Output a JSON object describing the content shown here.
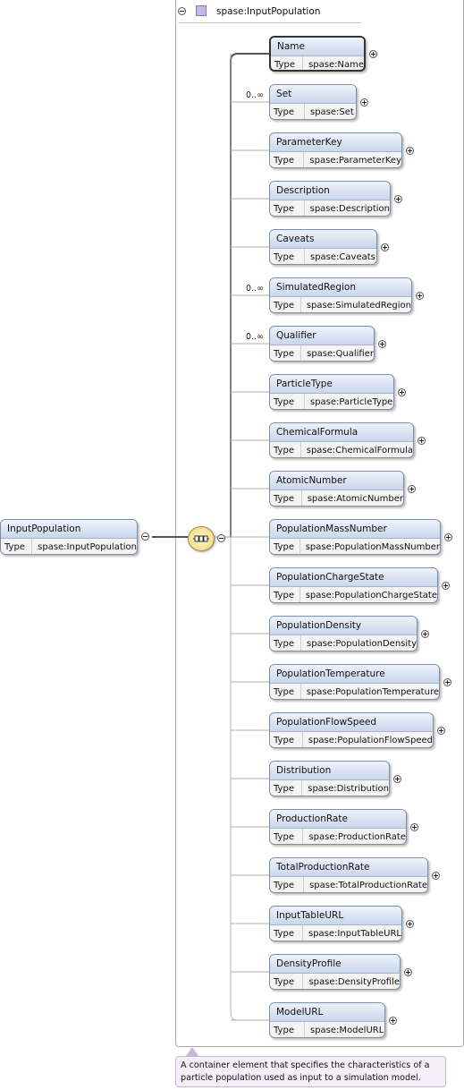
{
  "root": {
    "name": "InputPopulation",
    "type_label": "Type",
    "type_value": "spase:InputPopulation"
  },
  "group": {
    "title": "spase:InputPopulation"
  },
  "elements": [
    {
      "name": "Name",
      "type_label": "Type",
      "type_value": "spase:Name",
      "occurrence": ""
    },
    {
      "name": "Set",
      "type_label": "Type",
      "type_value": "spase:Set",
      "occurrence": "0..∞"
    },
    {
      "name": "ParameterKey",
      "type_label": "Type",
      "type_value": "spase:ParameterKey",
      "occurrence": ""
    },
    {
      "name": "Description",
      "type_label": "Type",
      "type_value": "spase:Description",
      "occurrence": ""
    },
    {
      "name": "Caveats",
      "type_label": "Type",
      "type_value": "spase:Caveats",
      "occurrence": ""
    },
    {
      "name": "SimulatedRegion",
      "type_label": "Type",
      "type_value": "spase:SimulatedRegion",
      "occurrence": "0..∞"
    },
    {
      "name": "Qualifier",
      "type_label": "Type",
      "type_value": "spase:Qualifier",
      "occurrence": "0..∞"
    },
    {
      "name": "ParticleType",
      "type_label": "Type",
      "type_value": "spase:ParticleType",
      "occurrence": ""
    },
    {
      "name": "ChemicalFormula",
      "type_label": "Type",
      "type_value": "spase:ChemicalFormula",
      "occurrence": ""
    },
    {
      "name": "AtomicNumber",
      "type_label": "Type",
      "type_value": "spase:AtomicNumber",
      "occurrence": ""
    },
    {
      "name": "PopulationMassNumber",
      "type_label": "Type",
      "type_value": "spase:PopulationMassNumber",
      "occurrence": ""
    },
    {
      "name": "PopulationChargeState",
      "type_label": "Type",
      "type_value": "spase:PopulationChargeState",
      "occurrence": ""
    },
    {
      "name": "PopulationDensity",
      "type_label": "Type",
      "type_value": "spase:PopulationDensity",
      "occurrence": ""
    },
    {
      "name": "PopulationTemperature",
      "type_label": "Type",
      "type_value": "spase:PopulationTemperature",
      "occurrence": ""
    },
    {
      "name": "PopulationFlowSpeed",
      "type_label": "Type",
      "type_value": "spase:PopulationFlowSpeed",
      "occurrence": ""
    },
    {
      "name": "Distribution",
      "type_label": "Type",
      "type_value": "spase:Distribution",
      "occurrence": ""
    },
    {
      "name": "ProductionRate",
      "type_label": "Type",
      "type_value": "spase:ProductionRate",
      "occurrence": ""
    },
    {
      "name": "TotalProductionRate",
      "type_label": "Type",
      "type_value": "spase:TotalProductionRate",
      "occurrence": ""
    },
    {
      "name": "InputTableURL",
      "type_label": "Type",
      "type_value": "spase:InputTableURL",
      "occurrence": ""
    },
    {
      "name": "DensityProfile",
      "type_label": "Type",
      "type_value": "spase:DensityProfile",
      "occurrence": ""
    },
    {
      "name": "ModelURL",
      "type_label": "Type",
      "type_value": "spase:ModelURL",
      "occurrence": ""
    }
  ],
  "annotation": "A container element that specifies the characteristics of a particle population used as input to a simulation model."
}
